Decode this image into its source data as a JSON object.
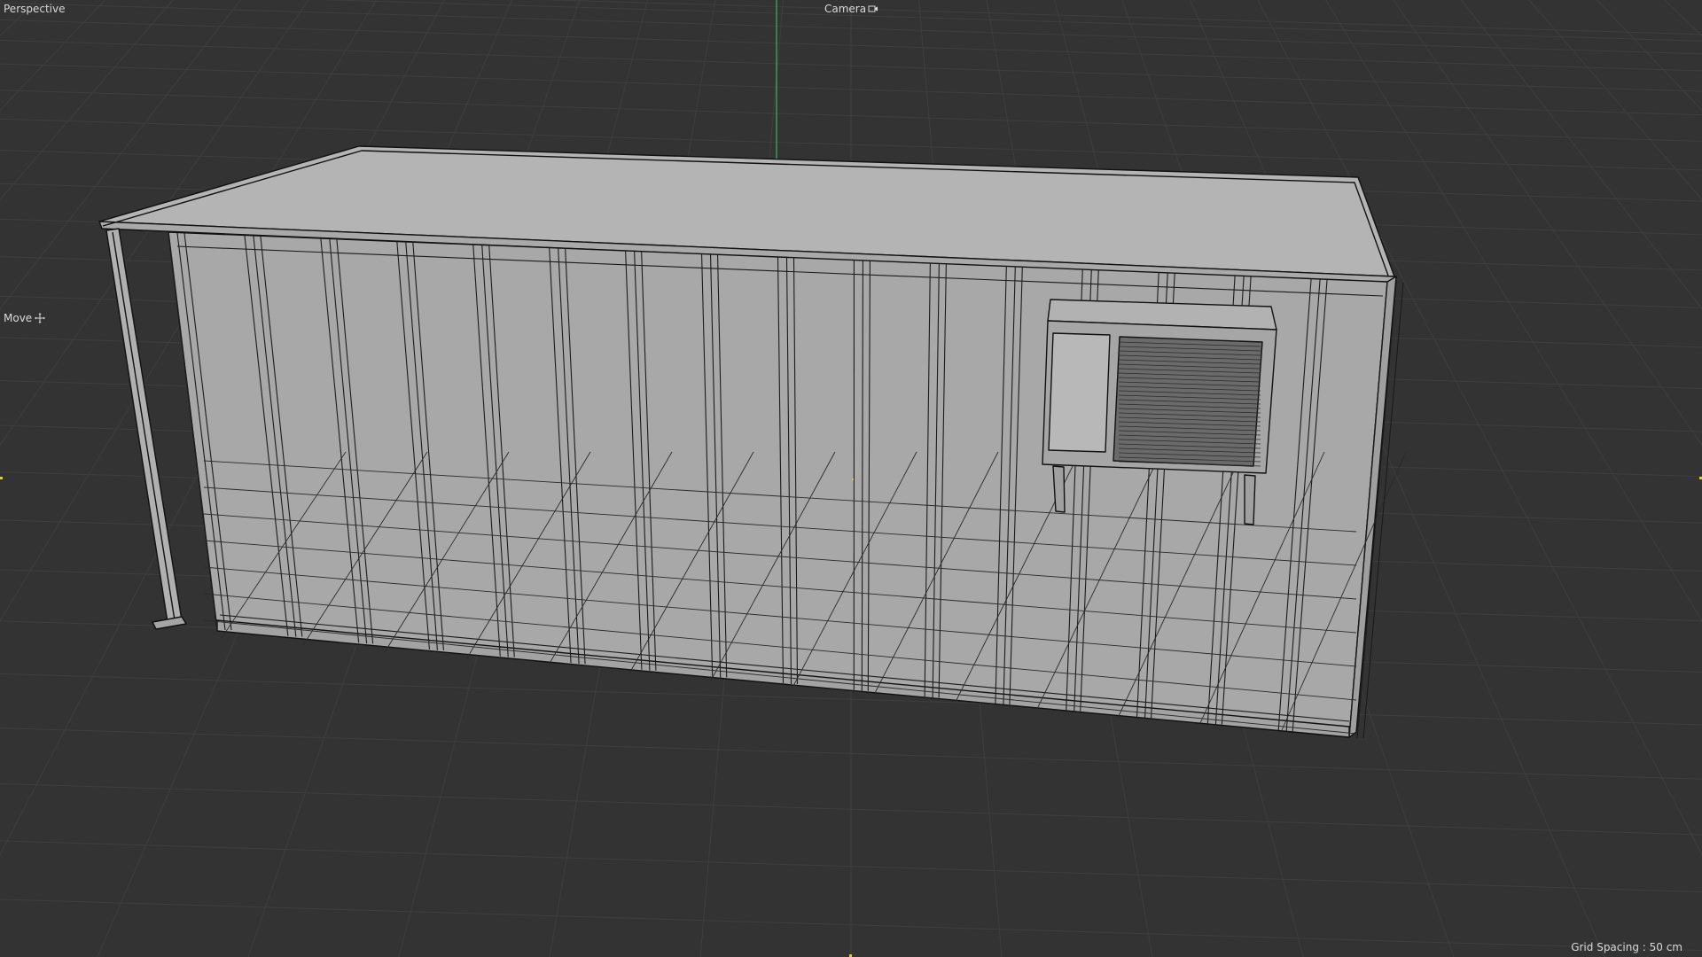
{
  "viewport": {
    "view_name": "Perspective",
    "camera_label": "Camera",
    "tool_label": "Move",
    "grid_spacing": "Grid Spacing : 50 cm"
  },
  "icons": {
    "camera": "camera-icon",
    "move": "move-icon"
  },
  "colors": {
    "background": "#333333",
    "grid_line": "#3f3f3f",
    "model_fill": "#aaaaaa",
    "wire": "#1a1a1a",
    "y_axis": "#3db36b",
    "hud_text": "#d9d9d9"
  },
  "model": {
    "name": "container-with-ac-unit"
  }
}
